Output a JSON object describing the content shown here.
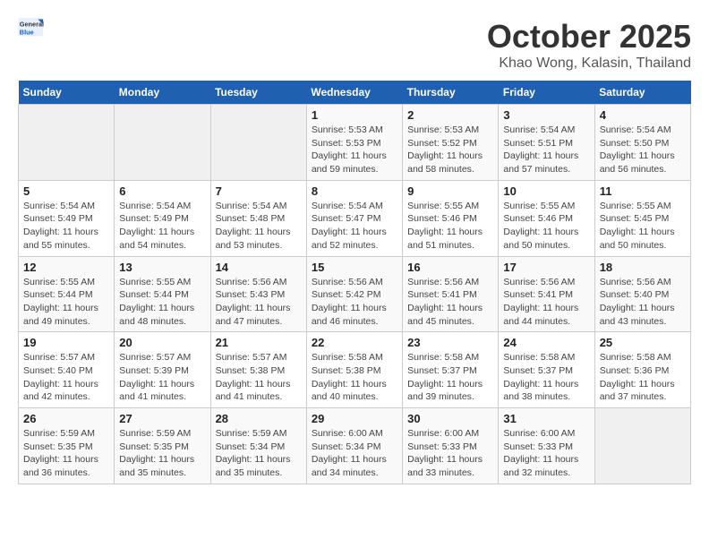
{
  "header": {
    "logo_general": "General",
    "logo_blue": "Blue",
    "month": "October 2025",
    "location": "Khao Wong, Kalasin, Thailand"
  },
  "weekdays": [
    "Sunday",
    "Monday",
    "Tuesday",
    "Wednesday",
    "Thursday",
    "Friday",
    "Saturday"
  ],
  "weeks": [
    [
      {
        "day": "",
        "info": ""
      },
      {
        "day": "",
        "info": ""
      },
      {
        "day": "",
        "info": ""
      },
      {
        "day": "1",
        "info": "Sunrise: 5:53 AM\nSunset: 5:53 PM\nDaylight: 11 hours and 59 minutes."
      },
      {
        "day": "2",
        "info": "Sunrise: 5:53 AM\nSunset: 5:52 PM\nDaylight: 11 hours and 58 minutes."
      },
      {
        "day": "3",
        "info": "Sunrise: 5:54 AM\nSunset: 5:51 PM\nDaylight: 11 hours and 57 minutes."
      },
      {
        "day": "4",
        "info": "Sunrise: 5:54 AM\nSunset: 5:50 PM\nDaylight: 11 hours and 56 minutes."
      }
    ],
    [
      {
        "day": "5",
        "info": "Sunrise: 5:54 AM\nSunset: 5:49 PM\nDaylight: 11 hours and 55 minutes."
      },
      {
        "day": "6",
        "info": "Sunrise: 5:54 AM\nSunset: 5:49 PM\nDaylight: 11 hours and 54 minutes."
      },
      {
        "day": "7",
        "info": "Sunrise: 5:54 AM\nSunset: 5:48 PM\nDaylight: 11 hours and 53 minutes."
      },
      {
        "day": "8",
        "info": "Sunrise: 5:54 AM\nSunset: 5:47 PM\nDaylight: 11 hours and 52 minutes."
      },
      {
        "day": "9",
        "info": "Sunrise: 5:55 AM\nSunset: 5:46 PM\nDaylight: 11 hours and 51 minutes."
      },
      {
        "day": "10",
        "info": "Sunrise: 5:55 AM\nSunset: 5:46 PM\nDaylight: 11 hours and 50 minutes."
      },
      {
        "day": "11",
        "info": "Sunrise: 5:55 AM\nSunset: 5:45 PM\nDaylight: 11 hours and 50 minutes."
      }
    ],
    [
      {
        "day": "12",
        "info": "Sunrise: 5:55 AM\nSunset: 5:44 PM\nDaylight: 11 hours and 49 minutes."
      },
      {
        "day": "13",
        "info": "Sunrise: 5:55 AM\nSunset: 5:44 PM\nDaylight: 11 hours and 48 minutes."
      },
      {
        "day": "14",
        "info": "Sunrise: 5:56 AM\nSunset: 5:43 PM\nDaylight: 11 hours and 47 minutes."
      },
      {
        "day": "15",
        "info": "Sunrise: 5:56 AM\nSunset: 5:42 PM\nDaylight: 11 hours and 46 minutes."
      },
      {
        "day": "16",
        "info": "Sunrise: 5:56 AM\nSunset: 5:41 PM\nDaylight: 11 hours and 45 minutes."
      },
      {
        "day": "17",
        "info": "Sunrise: 5:56 AM\nSunset: 5:41 PM\nDaylight: 11 hours and 44 minutes."
      },
      {
        "day": "18",
        "info": "Sunrise: 5:56 AM\nSunset: 5:40 PM\nDaylight: 11 hours and 43 minutes."
      }
    ],
    [
      {
        "day": "19",
        "info": "Sunrise: 5:57 AM\nSunset: 5:40 PM\nDaylight: 11 hours and 42 minutes."
      },
      {
        "day": "20",
        "info": "Sunrise: 5:57 AM\nSunset: 5:39 PM\nDaylight: 11 hours and 41 minutes."
      },
      {
        "day": "21",
        "info": "Sunrise: 5:57 AM\nSunset: 5:38 PM\nDaylight: 11 hours and 41 minutes."
      },
      {
        "day": "22",
        "info": "Sunrise: 5:58 AM\nSunset: 5:38 PM\nDaylight: 11 hours and 40 minutes."
      },
      {
        "day": "23",
        "info": "Sunrise: 5:58 AM\nSunset: 5:37 PM\nDaylight: 11 hours and 39 minutes."
      },
      {
        "day": "24",
        "info": "Sunrise: 5:58 AM\nSunset: 5:37 PM\nDaylight: 11 hours and 38 minutes."
      },
      {
        "day": "25",
        "info": "Sunrise: 5:58 AM\nSunset: 5:36 PM\nDaylight: 11 hours and 37 minutes."
      }
    ],
    [
      {
        "day": "26",
        "info": "Sunrise: 5:59 AM\nSunset: 5:35 PM\nDaylight: 11 hours and 36 minutes."
      },
      {
        "day": "27",
        "info": "Sunrise: 5:59 AM\nSunset: 5:35 PM\nDaylight: 11 hours and 35 minutes."
      },
      {
        "day": "28",
        "info": "Sunrise: 5:59 AM\nSunset: 5:34 PM\nDaylight: 11 hours and 35 minutes."
      },
      {
        "day": "29",
        "info": "Sunrise: 6:00 AM\nSunset: 5:34 PM\nDaylight: 11 hours and 34 minutes."
      },
      {
        "day": "30",
        "info": "Sunrise: 6:00 AM\nSunset: 5:33 PM\nDaylight: 11 hours and 33 minutes."
      },
      {
        "day": "31",
        "info": "Sunrise: 6:00 AM\nSunset: 5:33 PM\nDaylight: 11 hours and 32 minutes."
      },
      {
        "day": "",
        "info": ""
      }
    ]
  ]
}
